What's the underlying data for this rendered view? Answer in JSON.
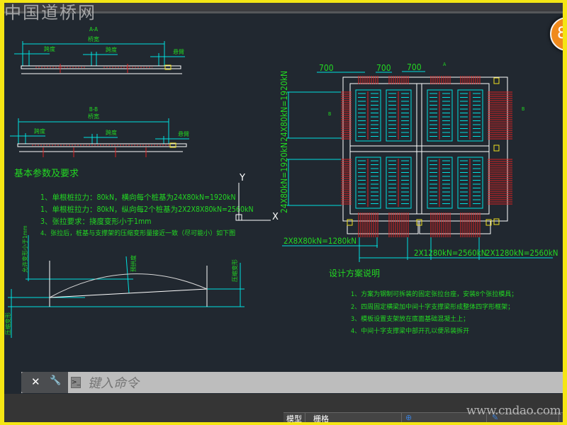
{
  "watermark_top": "中国道桥网",
  "watermark_bottom": "www.cndao.com",
  "badge": "8",
  "colors": {
    "canvas": "#212830",
    "text": "#22d822",
    "dimension": "#00e0e0",
    "section": "#e02020",
    "outline": "#ffffff",
    "border": "#f5e614"
  },
  "section_aa": {
    "title": "A-A",
    "total": "桥宽",
    "left": "跨度",
    "mid": "跨度",
    "right": "悬臂"
  },
  "section_bb": {
    "title": "B-B",
    "total": "桥宽",
    "left": "跨度",
    "mid": "跨度",
    "right": "悬臂"
  },
  "requirements": {
    "title": "基本参数及要求",
    "items": [
      "1、单根桩拉力：80kN，横向每个桩基为24X80kN=1920kN",
      "1、单根桩拉力：80kN，纵向每2个桩基为2X2X8X80kN=2560kN",
      "3、张拉要求：挠度变形小于1mm",
      "4、张拉后，桩基与支撑架的压缩变形量接近一致（尽可能小）如下图"
    ]
  },
  "deflection": {
    "left_label": "允许变形小于1mm",
    "mid_label": "预拱度",
    "right_label": "压缩变形",
    "bottom_label": "压缩变形"
  },
  "ucs": {
    "x": "X",
    "y": "Y"
  },
  "plan": {
    "dims": [
      "700",
      "700",
      "700"
    ],
    "vertical_top": "24X80kN=1920kN",
    "vertical_bottom": "24X80kN=1920kN",
    "bottom_left": "2X8X80kN=1280kN",
    "bottom_mid": "2X1280kN=2560kN",
    "bottom_right": "2X1280kN=2560kN",
    "cut_a": "A",
    "cut_b": "B"
  },
  "design": {
    "title": "设计方案说明",
    "items": [
      "1、方案为钢制可拆装的固定张拉台座，安装8个张拉模具；",
      "2、四周固定横梁加中间十字支撑梁形成整体四字形框架；",
      "3、模板设置支架放在底面基础混凝土上；",
      "4、中间十字支撑梁中部开孔以便吊装拆开"
    ]
  },
  "command": {
    "close": "✕",
    "settings": "🔧",
    "placeholder": "键入命令"
  },
  "status": {
    "model": "模型",
    "grid": "栅格"
  }
}
